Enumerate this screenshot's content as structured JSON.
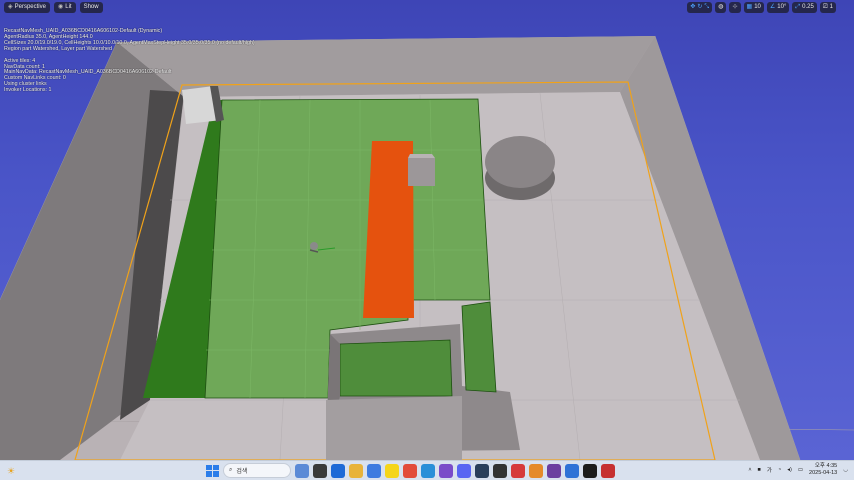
{
  "toolbar": {
    "left": [
      {
        "label": "Perspective",
        "icon": "perspective-icon"
      },
      {
        "label": "Lit",
        "icon": "lit-icon"
      },
      {
        "label": "Show",
        "icon": "show-icon"
      }
    ],
    "right": [
      {
        "label": "",
        "icon": "transform-icon"
      },
      {
        "label": "",
        "icon": "world-icon"
      },
      {
        "label": "",
        "icon": "surface-snap-icon"
      },
      {
        "label": "10",
        "icon": "grid-snap-icon"
      },
      {
        "label": "10°",
        "icon": "rotation-snap-icon"
      },
      {
        "label": "0.25",
        "icon": "scale-snap-icon"
      },
      {
        "label": "1",
        "icon": "camera-speed-icon"
      }
    ]
  },
  "stats": {
    "line1": "RecastNavMesh_UAID_A036BCD0416A606102-Default (Dynamic)",
    "line2": "AgentRadius 35.0, AgentHeight 144.0",
    "line3": "CellSizes 20.0/19.0/19.0, CellHeights 10.0/10.0/10.0, AgentMaxStepHeight 35.0/35.0/35.0 (no default/high)",
    "line4": "Region part Watershed, Layer part Watershed",
    "line5": "Active tiles: 4",
    "line6": "NavData count: 1",
    "line7": "MainNavData: RecastNavMesh_UAID_A036BCD0416A606102-Default",
    "line8": "Custom NavLinks count: 0",
    "line9": "Using cluster links",
    "line10": "Invoker Locations: 1"
  },
  "scene": {
    "floor_color": "#b9b2b5",
    "wall_color": "#8b8689",
    "navmesh_color": "#6fa858",
    "navmesh_edge_color": "#2f7a1c",
    "obstacle_color": "#e5520e",
    "bounds_color": "#f0a21a"
  },
  "taskbar": {
    "search_placeholder": "검색",
    "apps": [
      {
        "icon": "widgets-icon",
        "color": "#5b8ad6"
      },
      {
        "icon": "task-view-icon",
        "color": "#3a3a3a"
      },
      {
        "icon": "mail-icon",
        "color": "#1e6ad6"
      },
      {
        "icon": "file-explorer-icon",
        "color": "#e8b33a"
      },
      {
        "icon": "store-icon",
        "color": "#3d7be0"
      },
      {
        "icon": "kakaotalk-icon",
        "color": "#f5d51a"
      },
      {
        "icon": "chrome-icon",
        "color": "#e24b3a"
      },
      {
        "icon": "vscode-icon",
        "color": "#2a8fd8"
      },
      {
        "icon": "visual-studio-icon",
        "color": "#7a4cc9"
      },
      {
        "icon": "discord-icon",
        "color": "#5865f2"
      },
      {
        "icon": "steam-icon",
        "color": "#2a3f5a"
      },
      {
        "icon": "terminal-icon",
        "color": "#333"
      },
      {
        "icon": "app-red-icon",
        "color": "#d63a3a"
      },
      {
        "icon": "app-orange-icon",
        "color": "#e58a2a"
      },
      {
        "icon": "app-purple-icon",
        "color": "#6b3fa0"
      },
      {
        "icon": "app-blue-icon",
        "color": "#2f72d6"
      },
      {
        "icon": "unreal-engine-icon",
        "color": "#1c1c1c"
      },
      {
        "icon": "app-red2-icon",
        "color": "#c63030"
      }
    ],
    "clock_time": "오후 4:35",
    "clock_date": "2025-04-13"
  }
}
